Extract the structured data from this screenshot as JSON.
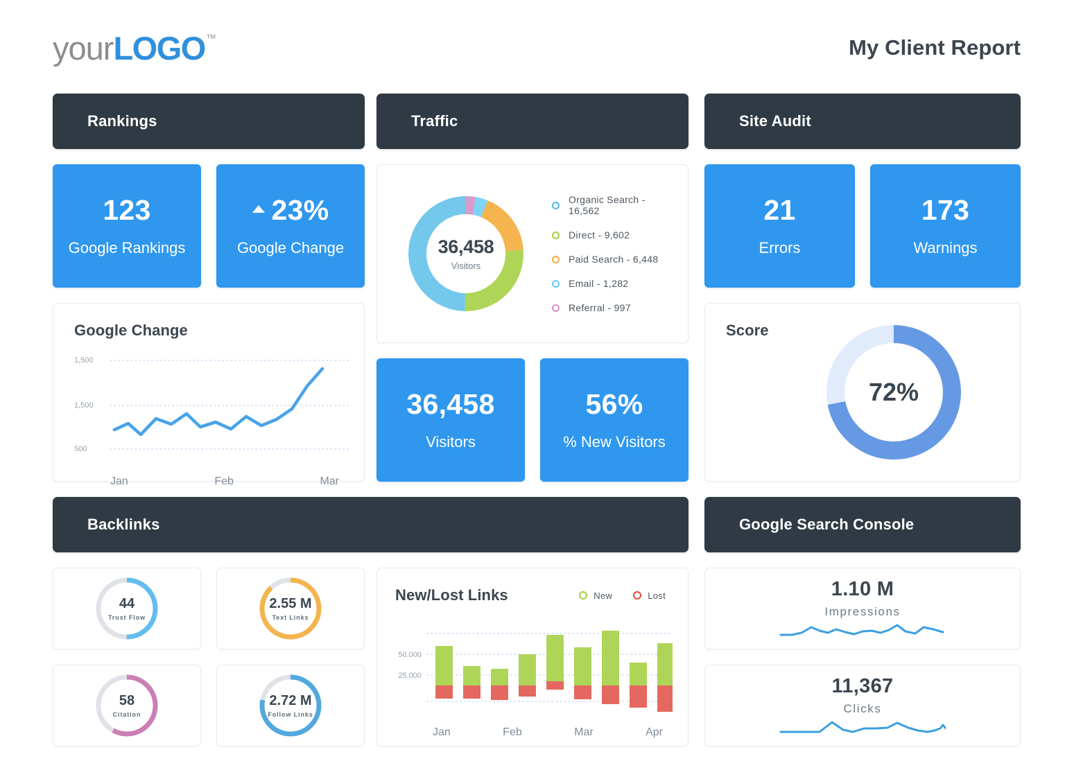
{
  "header": {
    "logo_prefix": "your",
    "logo_bold": "LOGO",
    "logo_tm": "™",
    "report_title": "My Client Report"
  },
  "colors": {
    "accent_blue": "#2f97ee",
    "header_dark": "#2f3a44",
    "green": "#aed558",
    "red": "#e4685f",
    "orange": "#f5b44e",
    "pink": "#d79ccb",
    "light_blue": "#73c8ec",
    "score_blue": "#6699e3",
    "score_track": "#e0ecfb",
    "gauge_track": "#dfe3e8"
  },
  "sections": {
    "rankings": {
      "title": "Rankings"
    },
    "traffic": {
      "title": "Traffic"
    },
    "site_audit": {
      "title": "Site Audit"
    },
    "backlinks": {
      "title": "Backlinks"
    },
    "search_console": {
      "title": "Google Search Console"
    }
  },
  "rankings": {
    "kpis": [
      {
        "value": "123",
        "label": "Google Rankings",
        "arrow": false
      },
      {
        "value": "23%",
        "label": "Google Change",
        "arrow": true
      }
    ],
    "chart_title": "Google Change"
  },
  "site_audit": {
    "kpis": [
      {
        "value": "21",
        "label": "Errors"
      },
      {
        "value": "173",
        "label": "Warnings"
      }
    ],
    "score_title": "Score",
    "score_value": "72%"
  },
  "traffic": {
    "donut_center_value": "36,458",
    "donut_center_label": "Visitors",
    "legend": [
      {
        "label": "Organic Search - 16,562",
        "color": "#73c8ec"
      },
      {
        "label": "Direct - 9,602",
        "color": "#aed558"
      },
      {
        "label": "Paid Search - 6,448",
        "color": "#f5b44e"
      },
      {
        "label": "Email - 1,282",
        "color": "#7fd3f5"
      },
      {
        "label": "Referral - 997",
        "color": "#d79ccb"
      }
    ],
    "kpis": [
      {
        "value": "36,458",
        "label": "Visitors"
      },
      {
        "value": "56%",
        "label": "% New Visitors"
      }
    ]
  },
  "backlinks": {
    "gauges": [
      {
        "value": "44",
        "label": "Trust Flow",
        "percent": 50,
        "color": "#63bdef"
      },
      {
        "value": "2.55 M",
        "label": "Text Links",
        "percent": 88,
        "color": "#f5b44e"
      },
      {
        "value": "58",
        "label": "Citation",
        "percent": 58,
        "color": "#ca7fb5"
      },
      {
        "value": "2.72 M",
        "label": "Follow Links",
        "percent": 78,
        "color": "#52a8dd"
      }
    ],
    "chart_title": "New/Lost Links",
    "legend": [
      {
        "label": "New",
        "color": "#aed558"
      },
      {
        "label": "Lost",
        "color": "#e4685f"
      }
    ]
  },
  "search_console": {
    "metrics": [
      {
        "value": "1.10 M",
        "label": "Impressions"
      },
      {
        "value": "11,367",
        "label": "Clicks"
      }
    ]
  },
  "chart_data": [
    {
      "id": "google_change_line",
      "type": "line",
      "title": "Google Change",
      "xlabel": "",
      "ylabel": "",
      "xticks": [
        "Jan",
        "Feb",
        "Mar"
      ],
      "yticks": [
        "1,500",
        "1,500",
        "500"
      ],
      "ylim": [
        500,
        1500
      ],
      "grid": true,
      "color": "#4aa3e8",
      "x": [
        0,
        1,
        2,
        3,
        4,
        5,
        6,
        7,
        8,
        9,
        10,
        11,
        12,
        13,
        14,
        15,
        16,
        17,
        18,
        19
      ],
      "values": [
        700,
        760,
        660,
        810,
        770,
        870,
        740,
        790,
        730,
        840,
        760,
        810,
        900,
        1130,
        1400
      ]
    },
    {
      "id": "traffic_donut",
      "type": "pie",
      "title": "Traffic",
      "center_value": "36,458",
      "center_label": "Visitors",
      "legend_position": "right",
      "categories": [
        "Organic Search",
        "Direct",
        "Paid Search",
        "Email",
        "Referral"
      ],
      "values": [
        16562,
        9602,
        6448,
        1282,
        997
      ],
      "colors": [
        "#73c8ec",
        "#aed558",
        "#f5b44e",
        "#7fd3f5",
        "#d79ccb"
      ],
      "total": 36458
    },
    {
      "id": "site_audit_score",
      "type": "pie",
      "title": "Score",
      "center_value": "72%",
      "categories": [
        "Score",
        "Remaining"
      ],
      "values": [
        72,
        28
      ],
      "colors": [
        "#6699e3",
        "#e0ecfb"
      ]
    },
    {
      "id": "trust_flow_gauge",
      "type": "pie",
      "title": "Trust Flow",
      "center_value": "44",
      "values": [
        50,
        50
      ],
      "colors": [
        "#63bdef",
        "#dfe3e8"
      ]
    },
    {
      "id": "text_links_gauge",
      "type": "pie",
      "title": "Text Links",
      "center_value": "2.55 M",
      "values": [
        88,
        12
      ],
      "colors": [
        "#f5b44e",
        "#dfe3e8"
      ]
    },
    {
      "id": "citation_gauge",
      "type": "pie",
      "title": "Citation",
      "center_value": "58",
      "values": [
        58,
        42
      ],
      "colors": [
        "#ca7fb5",
        "#dfe3e8"
      ]
    },
    {
      "id": "follow_links_gauge",
      "type": "pie",
      "title": "Follow Links",
      "center_value": "2.72 M",
      "values": [
        78,
        22
      ],
      "colors": [
        "#52a8dd",
        "#dfe3e8"
      ]
    },
    {
      "id": "new_lost_links_bar",
      "type": "bar",
      "title": "New/Lost Links",
      "xticks": [
        "Jan",
        "Feb",
        "Mar",
        "Apr"
      ],
      "yticks": [
        "25,000",
        "50,000"
      ],
      "ylim": [
        0,
        75000
      ],
      "grid": true,
      "categories": [
        "1",
        "2",
        "3",
        "4",
        "5",
        "6",
        "7",
        "8",
        "9"
      ],
      "series": [
        {
          "name": "New",
          "color": "#aed558",
          "values": [
            58000,
            38000,
            34000,
            51000,
            67000,
            56000,
            72000,
            42000,
            61000
          ]
        },
        {
          "name": "Lost",
          "color": "#e4685f",
          "values": [
            -8000,
            -8000,
            -9000,
            -7000,
            -4000,
            -9000,
            -13000,
            -16000,
            -20000
          ]
        }
      ],
      "baseline": 20000
    },
    {
      "id": "impressions_spark",
      "type": "line",
      "title": "Impressions",
      "value": "1.10 M",
      "color": "#3a9fe0",
      "values": [
        8,
        8,
        9,
        14,
        18,
        14,
        12,
        16,
        19,
        14,
        12,
        15,
        16,
        13,
        15,
        22,
        14,
        9,
        20,
        19,
        12
      ]
    },
    {
      "id": "clicks_spark",
      "type": "line",
      "title": "Clicks",
      "value": "11,367",
      "color": "#3a9fe0",
      "values": [
        7,
        7,
        7,
        7,
        22,
        16,
        8,
        13,
        13,
        14,
        18,
        13,
        10,
        7,
        10,
        12,
        21,
        12,
        12,
        12,
        12
      ]
    }
  ]
}
